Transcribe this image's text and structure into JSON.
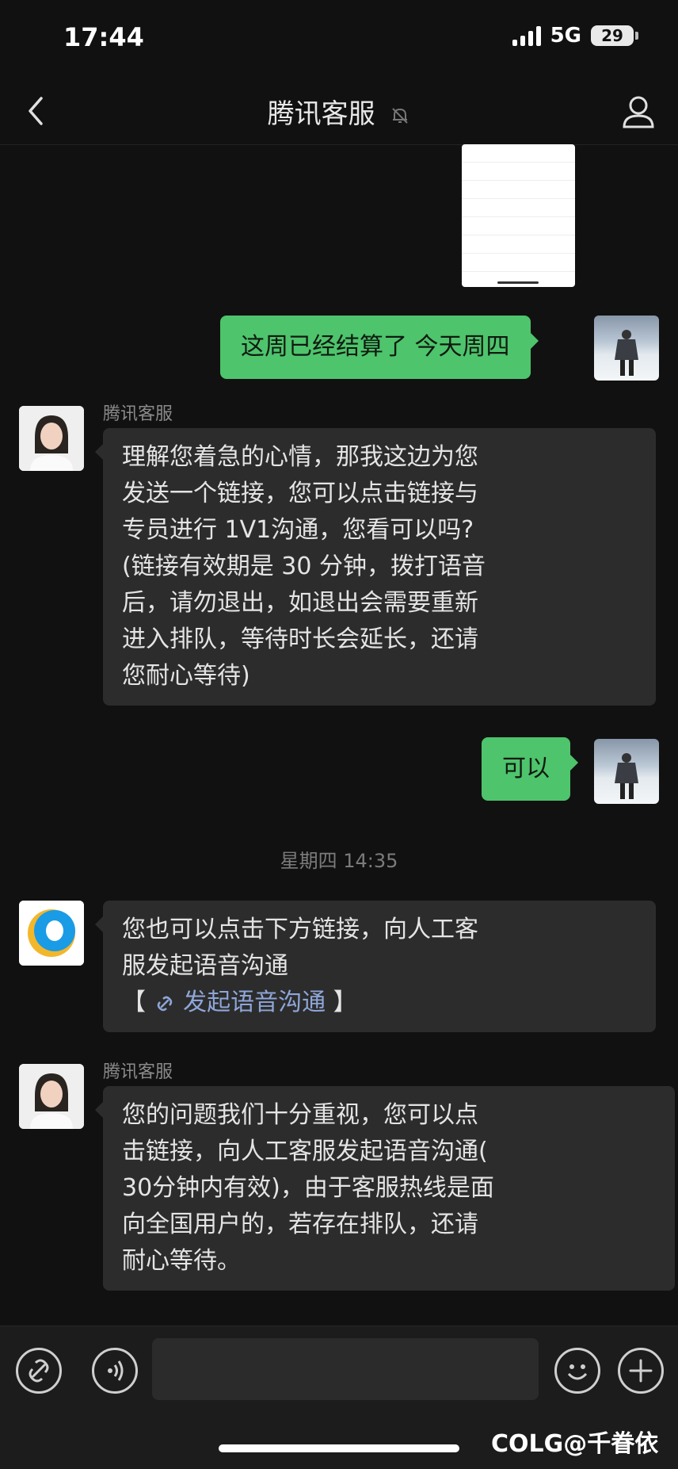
{
  "status_bar": {
    "time": "17:44",
    "network": "5G",
    "battery": "29"
  },
  "nav": {
    "title": "腾讯客服"
  },
  "messages": {
    "m1_text": "这周已经结算了  今天周四",
    "m2_sender": "腾讯客服",
    "m2_text": "理解您着急的心情，那我这边为您\n发送一个链接，您可以点击链接与\n专员进行 1V1沟通，您看可以吗?\n(链接有效期是 30 分钟，拨打语音\n后，请勿退出，如退出会需要重新\n进入排队，等待时长会延长，还请\n您耐心等待)",
    "m3_text": "可以",
    "timestamp": "星期四 14:35",
    "m4_text": "您也可以点击下方链接，向人工客\n服发起语音沟通",
    "m4_link_open": "【",
    "m4_link_label": "发起语音沟通",
    "m4_link_close": "】",
    "m5_sender": "腾讯客服",
    "m5_text": "您的问题我们十分重视，您可以点\n击链接，向人工客服发起语音沟通(\n30分钟内有效)，由于客服热线是面\n向全国用户的，若存在排队，还请\n耐心等待。"
  },
  "watermark": "COLG@千眷依",
  "colors": {
    "my_bubble": "#4ec46c",
    "their_bubble": "#2c2c2c",
    "link": "#8ea6d8",
    "background": "#111111"
  },
  "icons": [
    "back-icon",
    "bell-off-icon",
    "profile-icon",
    "link-icon",
    "voice-icon",
    "emoji-icon",
    "plus-icon"
  ]
}
